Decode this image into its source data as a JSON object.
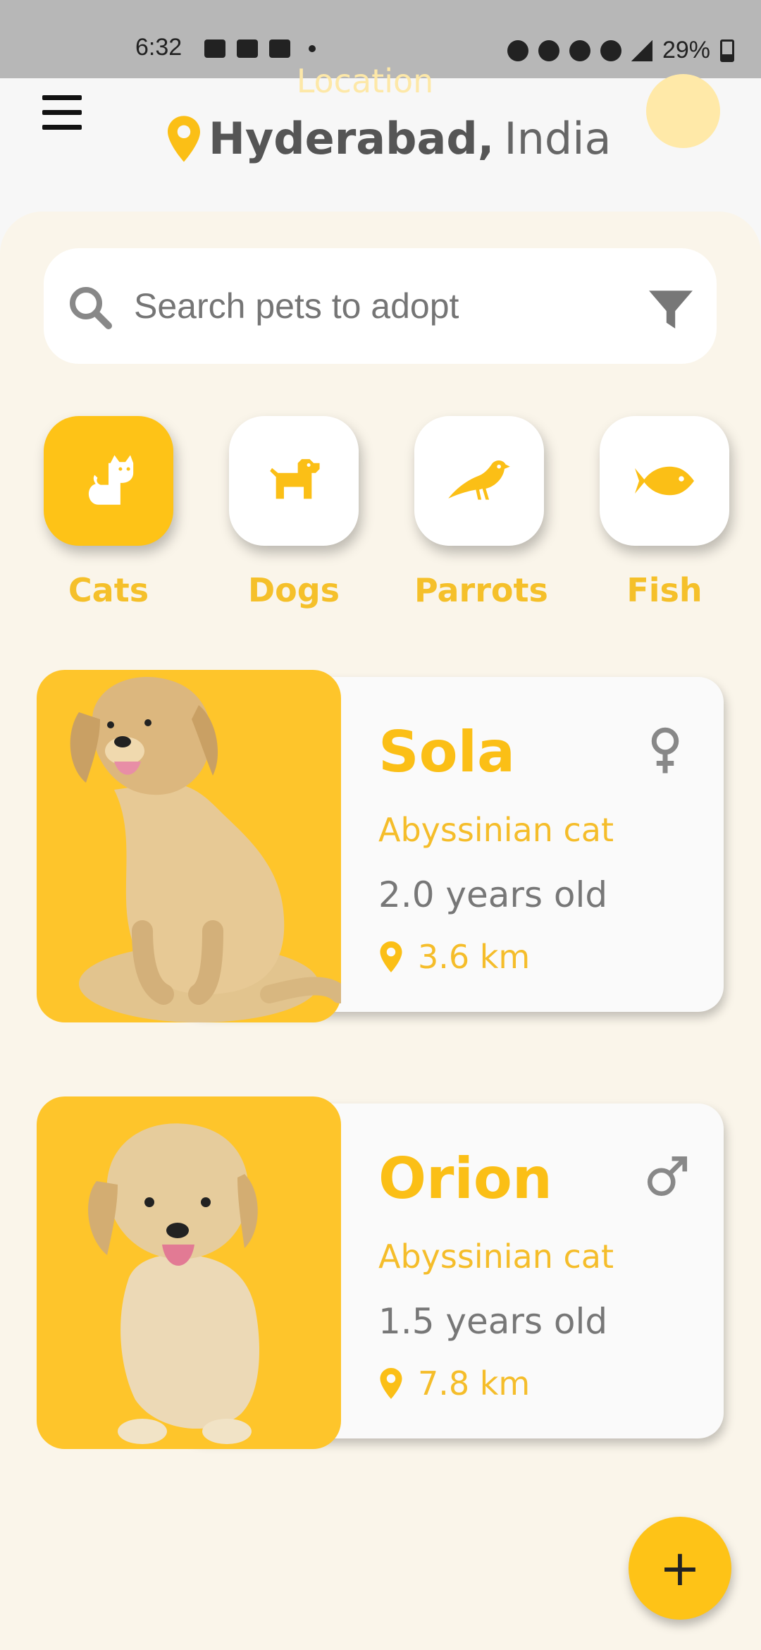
{
  "status_bar": {
    "time": "6:32",
    "battery": "29%"
  },
  "header": {
    "location_label": "Location",
    "city": "Hyderabad,",
    "country": "India"
  },
  "search": {
    "placeholder": "Search pets to adopt"
  },
  "categories": [
    {
      "label": "Cats",
      "icon": "cat-icon",
      "active": true
    },
    {
      "label": "Dogs",
      "icon": "dog-icon",
      "active": false
    },
    {
      "label": "Parrots",
      "icon": "bird-icon",
      "active": false
    },
    {
      "label": "Fish",
      "icon": "fish-icon",
      "active": false
    }
  ],
  "pets": [
    {
      "name": "Sola",
      "breed": "Abyssinian cat",
      "age": "2.0 years old",
      "distance": "3.6 km",
      "gender": "female"
    },
    {
      "name": "Orion",
      "breed": "Abyssinian cat",
      "age": "1.5 years old",
      "distance": "7.8 km",
      "gender": "male"
    }
  ],
  "fab": {
    "label": "+"
  },
  "colors": {
    "accent": "#fec317",
    "accent_text": "#f5bd2a",
    "panel": "#faf5ea",
    "location_label": "#fde8a8"
  }
}
